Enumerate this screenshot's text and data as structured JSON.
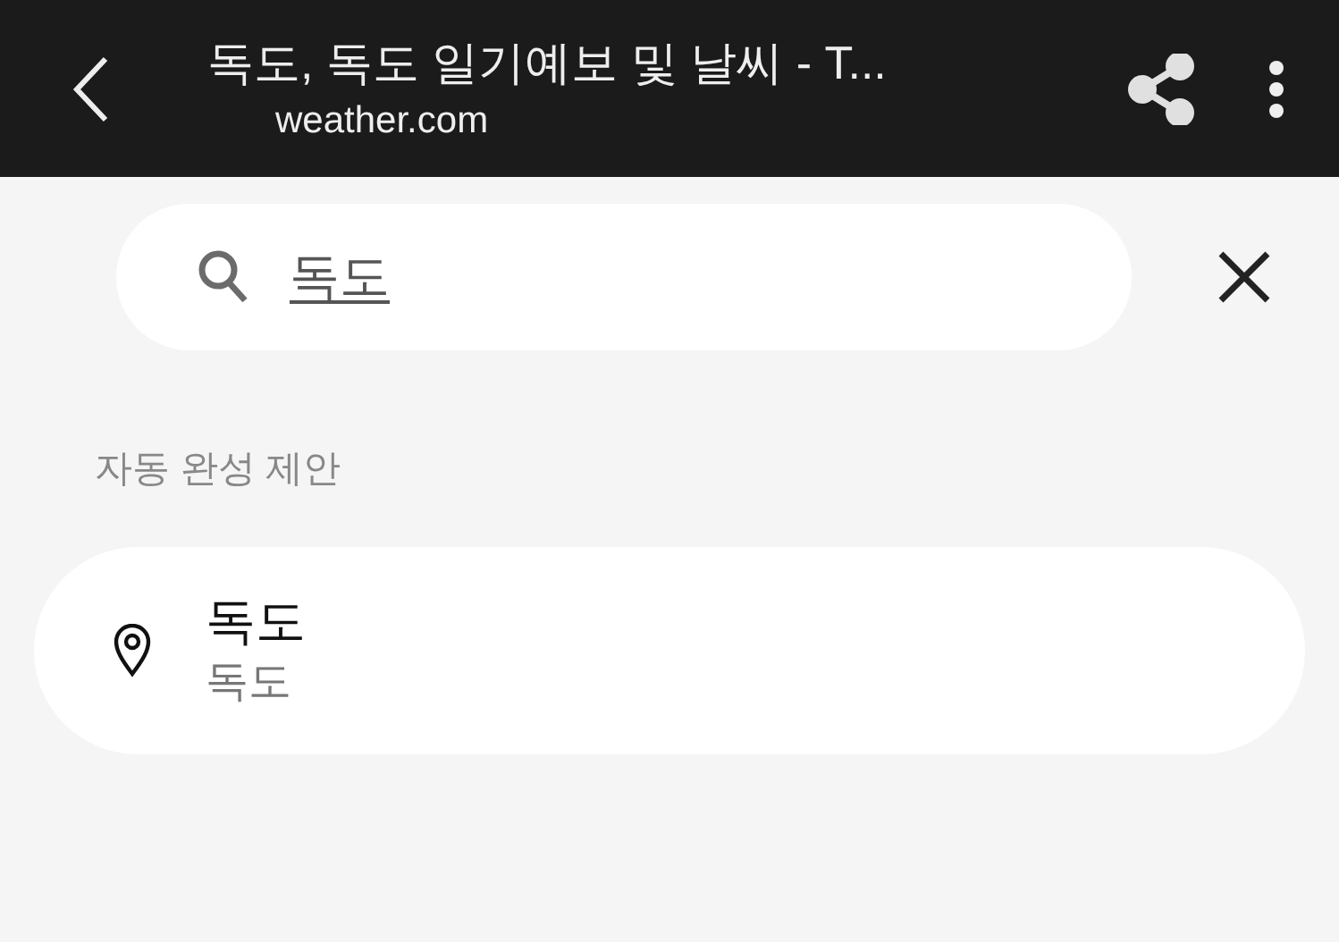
{
  "header": {
    "title": "독도, 독도 일기예보 및 날씨 - T...",
    "url": "weather.com"
  },
  "search": {
    "value": "독도"
  },
  "section_label": "자동 완성 제안",
  "suggestions": [
    {
      "title": "독도",
      "subtitle": "독도"
    }
  ]
}
